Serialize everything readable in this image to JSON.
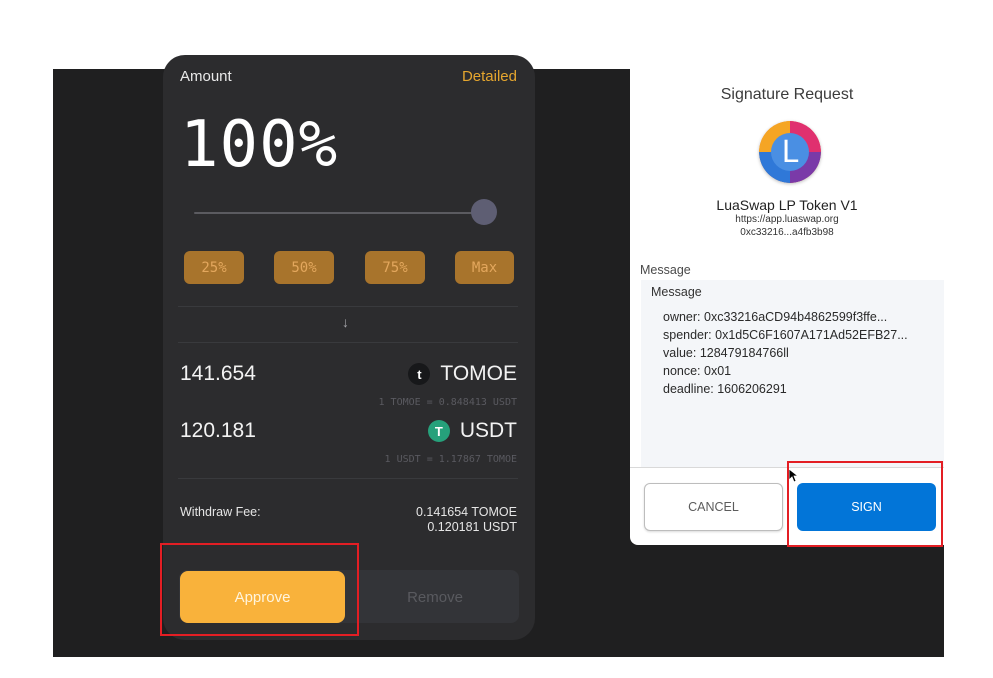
{
  "liquidity_panel": {
    "amount_label": "Amount",
    "detailed_link": "Detailed",
    "percent_display": "100%",
    "slider_level_percent": 100,
    "percent_buttons": [
      "25%",
      "50%",
      "75%",
      "Max"
    ],
    "tokens": [
      {
        "amount": "141.654",
        "symbol": "TOMOE",
        "icon": "tomoe-icon",
        "rate": "1 TOMOE = 0.848413 USDT"
      },
      {
        "amount": "120.181",
        "symbol": "USDT",
        "icon": "usdt-icon",
        "rate": "1 USDT = 1.17867 TOMOE"
      }
    ],
    "fee_label": "Withdraw Fee:",
    "fee_values": [
      "0.141654 TOMOE",
      "0.120181 USDT"
    ],
    "approve_label": "Approve",
    "remove_label": "Remove"
  },
  "signature_request": {
    "title": "Signature Request",
    "origin_name": "LuaSwap LP Token V1",
    "origin_url": "https://app.luaswap.org",
    "origin_address": "0xc33216...a4fb3b98",
    "message_section_label": "Message",
    "message_box_label": "Message",
    "message_lines": [
      "owner: 0xc33216aCD94b4862599f3ffe...",
      "spender: 0x1d5C6F1607A171Ad52EFB27...",
      "value: 128479184766ll",
      "nonce: 0x01",
      "deadline: 1606206291"
    ],
    "cancel_label": "CANCEL",
    "sign_label": "SIGN"
  },
  "colors": {
    "accent_orange": "#f9b23b",
    "sign_blue": "#0275d8",
    "highlight_red": "#e31e24"
  }
}
